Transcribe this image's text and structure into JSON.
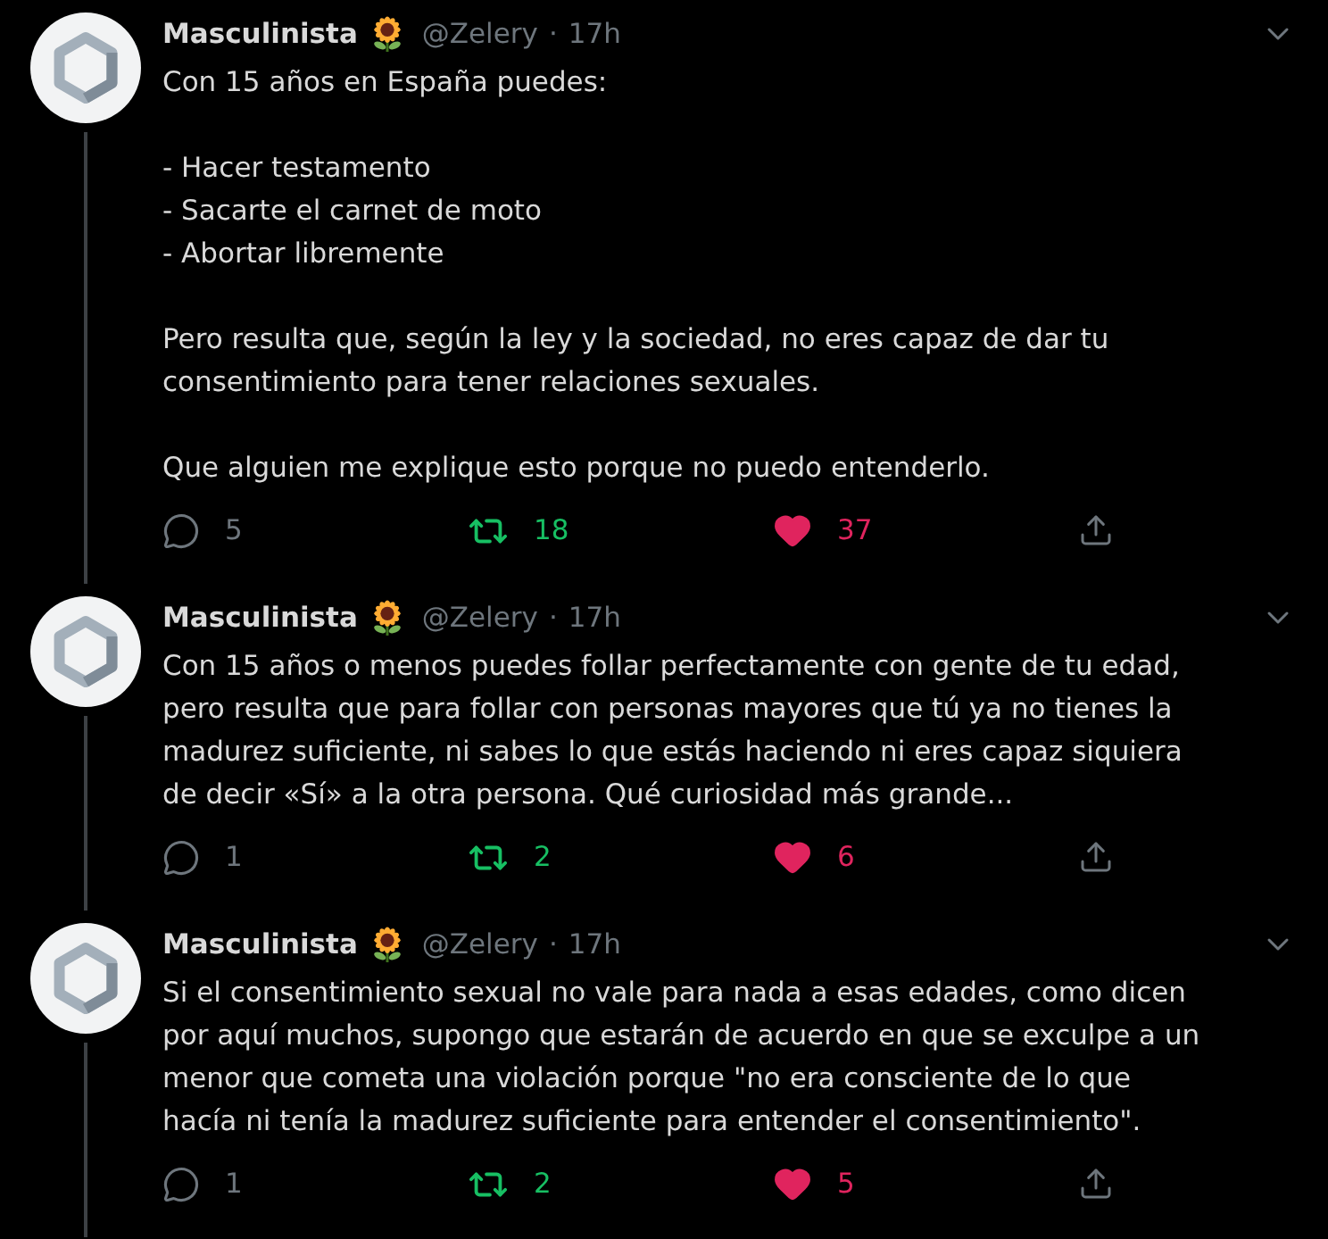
{
  "tweets": [
    {
      "author": {
        "name": "Masculinista",
        "handle": "@Zelery"
      },
      "separator": "·",
      "time": "17h",
      "text": "Con 15 años en España puedes:\n\n- Hacer testamento\n- Sacarte el carnet de moto\n- Abortar libremente\n\nPero resulta que, según la ley y la sociedad, no eres capaz de dar tu\nconsentimiento para tener relaciones sexuales.\n\nQue alguien me explique esto porque no puedo entenderlo.",
      "actions": [
        {
          "kind": "reply",
          "count": "5",
          "active": false
        },
        {
          "kind": "retweet",
          "count": "18",
          "active": true
        },
        {
          "kind": "like",
          "count": "37",
          "active": true
        },
        {
          "kind": "share",
          "active": false
        }
      ]
    },
    {
      "author": {
        "name": "Masculinista",
        "handle": "@Zelery"
      },
      "separator": "·",
      "time": "17h",
      "text": "Con 15 años o menos puedes follar perfectamente con gente de tu edad,\npero resulta que para follar con personas mayores que tú ya no tienes la\nmadurez suficiente, ni sabes lo que estás haciendo ni eres capaz siquiera\nde decir «Sí» a la otra persona. Qué curiosidad más grande...",
      "actions": [
        {
          "kind": "reply",
          "count": "1",
          "active": false
        },
        {
          "kind": "retweet",
          "count": "2",
          "active": true
        },
        {
          "kind": "like",
          "count": "6",
          "active": true
        },
        {
          "kind": "share",
          "active": false
        }
      ]
    },
    {
      "author": {
        "name": "Masculinista",
        "handle": "@Zelery"
      },
      "separator": "·",
      "time": "17h",
      "text": "Si el consentimiento sexual no vale para nada a esas edades, como dicen\npor aquí muchos, supongo que estarán de acuerdo en que se exculpe a un\nmenor que cometa una violación porque \"no era consciente de lo que\nhacía ni tenía la madurez suficiente para entender el consentimiento\".",
      "actions": [
        {
          "kind": "reply",
          "count": "1",
          "active": false
        },
        {
          "kind": "retweet",
          "count": "2",
          "active": true
        },
        {
          "kind": "like",
          "count": "5",
          "active": true
        },
        {
          "kind": "share",
          "active": false
        }
      ]
    }
  ]
}
